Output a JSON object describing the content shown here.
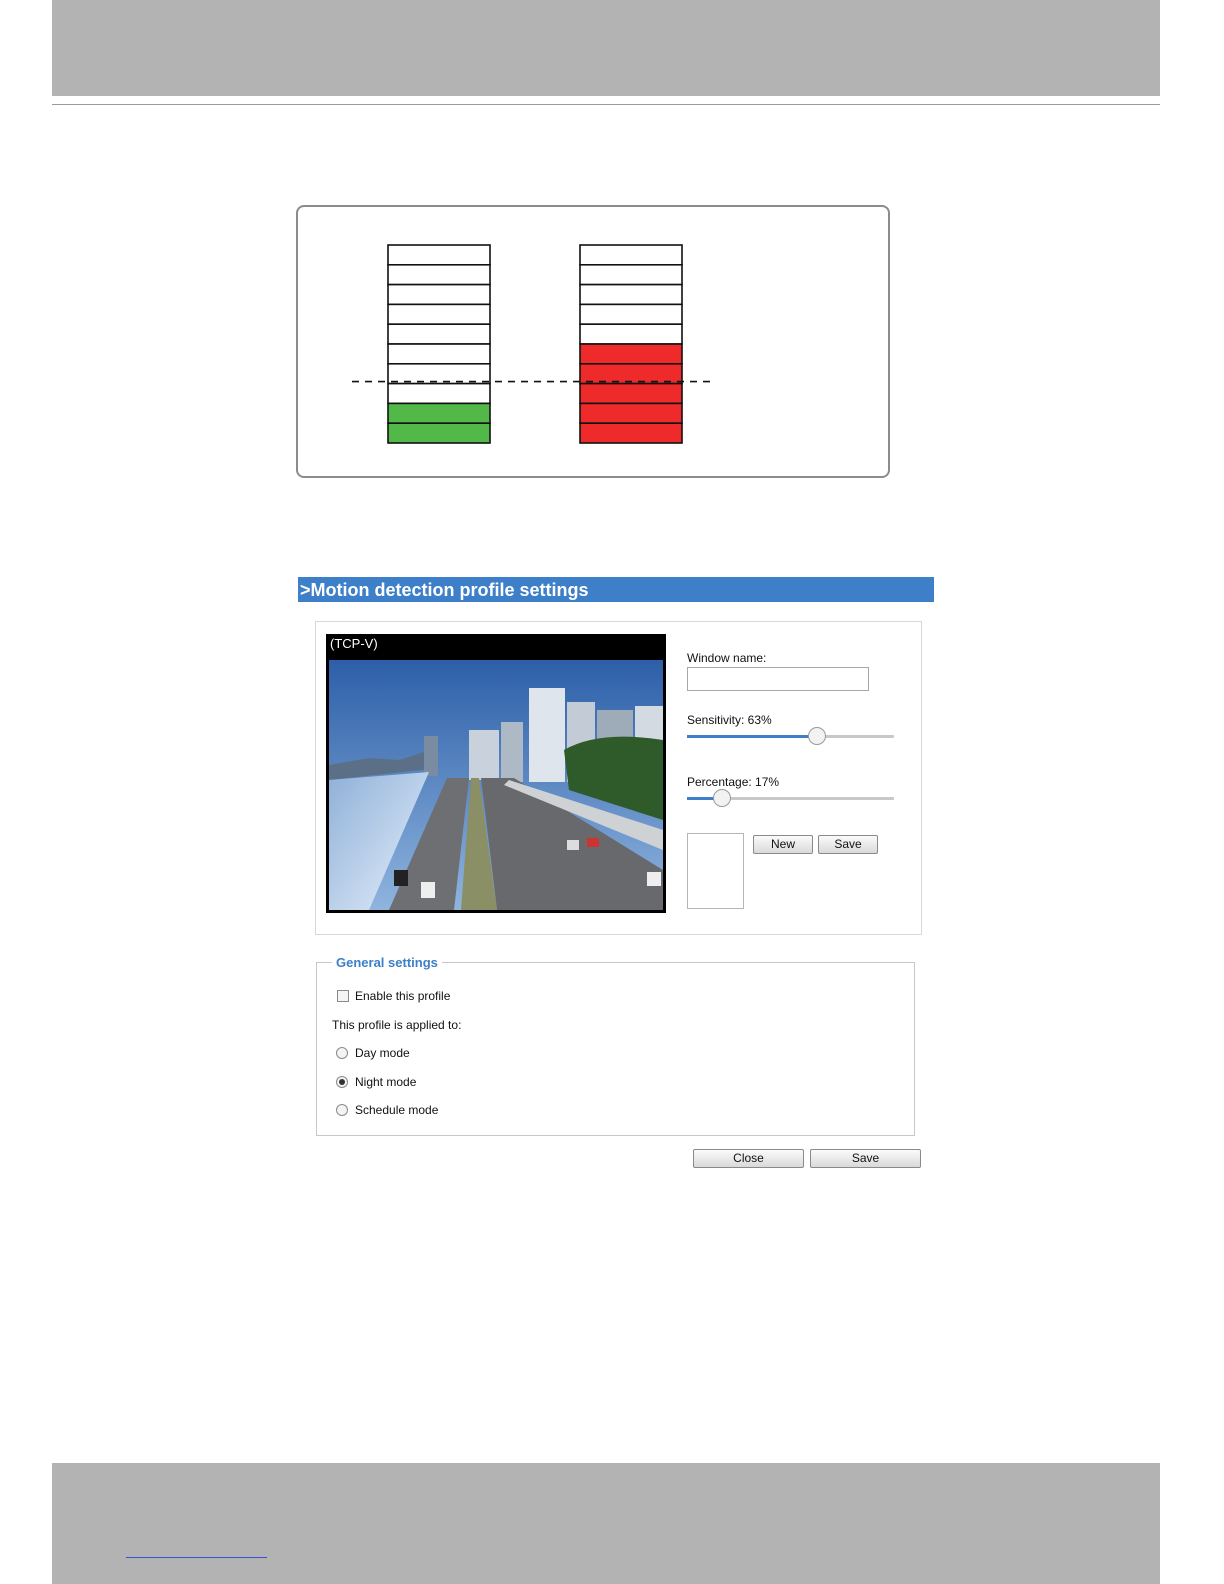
{
  "page": {
    "band_color": "#b3b3b3"
  },
  "diagram": {
    "cell_count": 10,
    "left_column": {
      "filled_cells": 2,
      "fill_color": "#52b948"
    },
    "right_column": {
      "filled_cells": 5,
      "fill_color": "#ee2a2a"
    },
    "threshold_cells": 3
  },
  "settings": {
    "header": ">Motion detection profile settings",
    "header_color": "#3d7fc8",
    "video": {
      "caption": "(TCP-V)"
    },
    "window_name": {
      "label": "Window name:",
      "value": ""
    },
    "sensitivity": {
      "label": "Sensitivity: 63%",
      "value": 0.63
    },
    "percentage": {
      "label": "Percentage: 17%",
      "value": 0.17
    },
    "buttons": {
      "new": "New",
      "save": "Save"
    }
  },
  "general": {
    "legend": "General settings",
    "enable_label": "Enable this profile",
    "enabled": false,
    "applied_label": "This profile is applied to:",
    "modes": [
      {
        "label": "Day mode",
        "selected": false
      },
      {
        "label": "Night mode",
        "selected": true
      },
      {
        "label": "Schedule mode",
        "selected": false
      }
    ]
  },
  "footer_buttons": {
    "close": "Close",
    "save": "Save"
  }
}
